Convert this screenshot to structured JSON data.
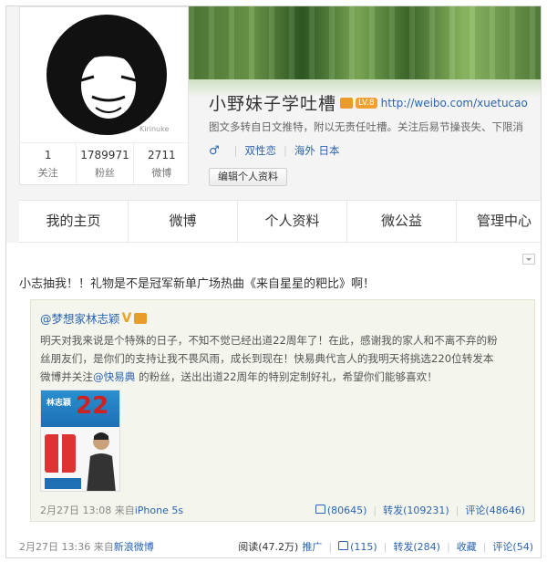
{
  "profile": {
    "name": "小野妹子学吐槽",
    "level": "LV.8",
    "url": "http://weibo.com/xuetucao",
    "bio": "图文多转自日文推特，附以无责任吐槽。关注后易节操丧失、下限消",
    "sex_icon": "male-symbol-icon",
    "tags": [
      "双性恋",
      "海外 日本"
    ],
    "edit_button": "编辑个人资料",
    "avatar_signature": "Kirinuke",
    "stats": [
      {
        "num": "1",
        "label": "关注"
      },
      {
        "num": "1789971",
        "label": "粉丝"
      },
      {
        "num": "2711",
        "label": "微博"
      }
    ]
  },
  "nav": [
    "我的主页",
    "微博",
    "个人资料",
    "微公益",
    "管理中心"
  ],
  "post": {
    "text": "小志抽我！！礼物是不是冠军新单广场热曲《来自星星的粑比》啊！",
    "repost": {
      "author": "@梦想家林志颖",
      "vip_mark": "V",
      "lines": [
        "明天对我来说是个特殊的日子，不知不觉已经出道22周年了！在此，感谢我的家人和不离不弃的粉",
        "丝朋友们，是你们的支持让我不畏风雨，成长到现在！快易典代言人的我明天将挑选220位转发本"
      ],
      "line3_mention": "@快易典",
      "line3_prefix": "微博并关注",
      "line3_suffix": " 的粉丝，送出出道22周年的特别定制好礼，希望你们能够喜欢！",
      "promo": {
        "name_text": "林志颖",
        "sub_text": "出道",
        "num": "22",
        "unit": "周年"
      },
      "date": "2月27日 13:08",
      "from_label": "来自",
      "source": "iPhone 5s",
      "likes": "(80645)",
      "forward": "转发(109231)",
      "comment": "评论(48646)"
    },
    "date": "2月27日 13:36",
    "from_label": "来自",
    "source": "新浪微博",
    "read": "阅读(47.2万)",
    "promote": "推广",
    "likes": "(115)",
    "forward": "转发(284)",
    "favorite": "收藏",
    "comment": "评论(54)"
  },
  "colors": {
    "link": "#2a64b0",
    "accent": "#e99b2c",
    "repost_bg": "#f4f6ee"
  }
}
